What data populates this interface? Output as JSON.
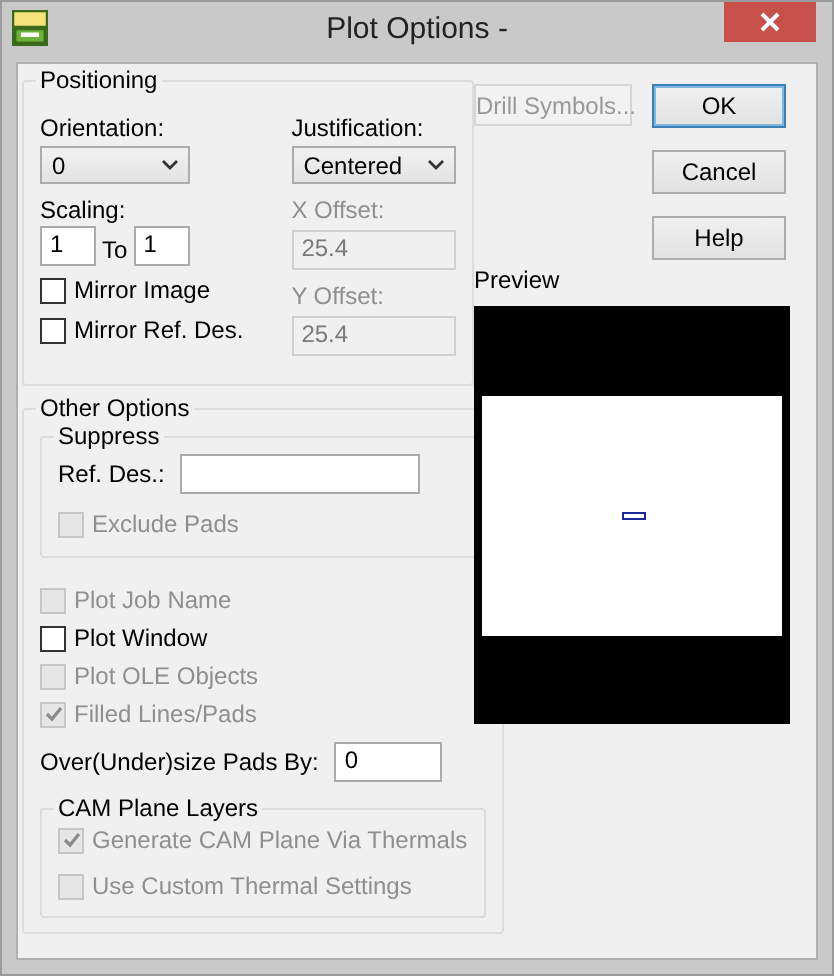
{
  "window": {
    "title": "Plot Options -"
  },
  "positioning": {
    "legend": "Positioning",
    "orientation": {
      "label": "Orientation:",
      "value": "0"
    },
    "justification": {
      "label": "Justification:",
      "value": "Centered"
    },
    "scaling": {
      "label": "Scaling:",
      "from": "1",
      "to_label": "To",
      "to": "1"
    },
    "x_offset": {
      "label": "X Offset:",
      "value": "25.4",
      "disabled": true
    },
    "y_offset": {
      "label": "Y Offset:",
      "value": "25.4",
      "disabled": true
    },
    "checkboxes": [
      {
        "label": "Mirror Image",
        "checked": false,
        "disabled": false
      },
      {
        "label": "Mirror Ref. Des.",
        "checked": false,
        "disabled": false
      }
    ]
  },
  "other_options": {
    "legend": "Other Options",
    "suppress": {
      "legend": "Suppress",
      "ref_des_label": "Ref. Des.:",
      "checkboxes": [
        {
          "label": "Exclude Pads",
          "checked": false,
          "disabled": true
        }
      ]
    },
    "checkboxes": [
      {
        "label": "Plot Job Name",
        "checked": false,
        "disabled": true
      },
      {
        "label": "Plot Window",
        "checked": false,
        "disabled": false
      },
      {
        "label": "Plot OLE Objects",
        "checked": false,
        "disabled": true
      },
      {
        "label": "Filled Lines/Pads",
        "checked": true,
        "disabled": true
      }
    ],
    "oversize": {
      "label": "Over(Under)size Pads By:",
      "value": "0"
    },
    "cam_plane": {
      "legend": "CAM Plane Layers",
      "checkboxes": [
        {
          "label": "Generate CAM Plane Via Thermals",
          "checked": true,
          "disabled": true
        },
        {
          "label": "Use Custom Thermal Settings",
          "checked": false,
          "disabled": true
        }
      ]
    }
  },
  "drill_symbols": {
    "label": "Drill Symbols...",
    "disabled": true
  },
  "buttons": [
    {
      "label": "OK",
      "default": true
    },
    {
      "label": "Cancel",
      "default": false
    },
    {
      "label": "Help",
      "default": false
    }
  ],
  "preview": {
    "label": "Preview"
  }
}
